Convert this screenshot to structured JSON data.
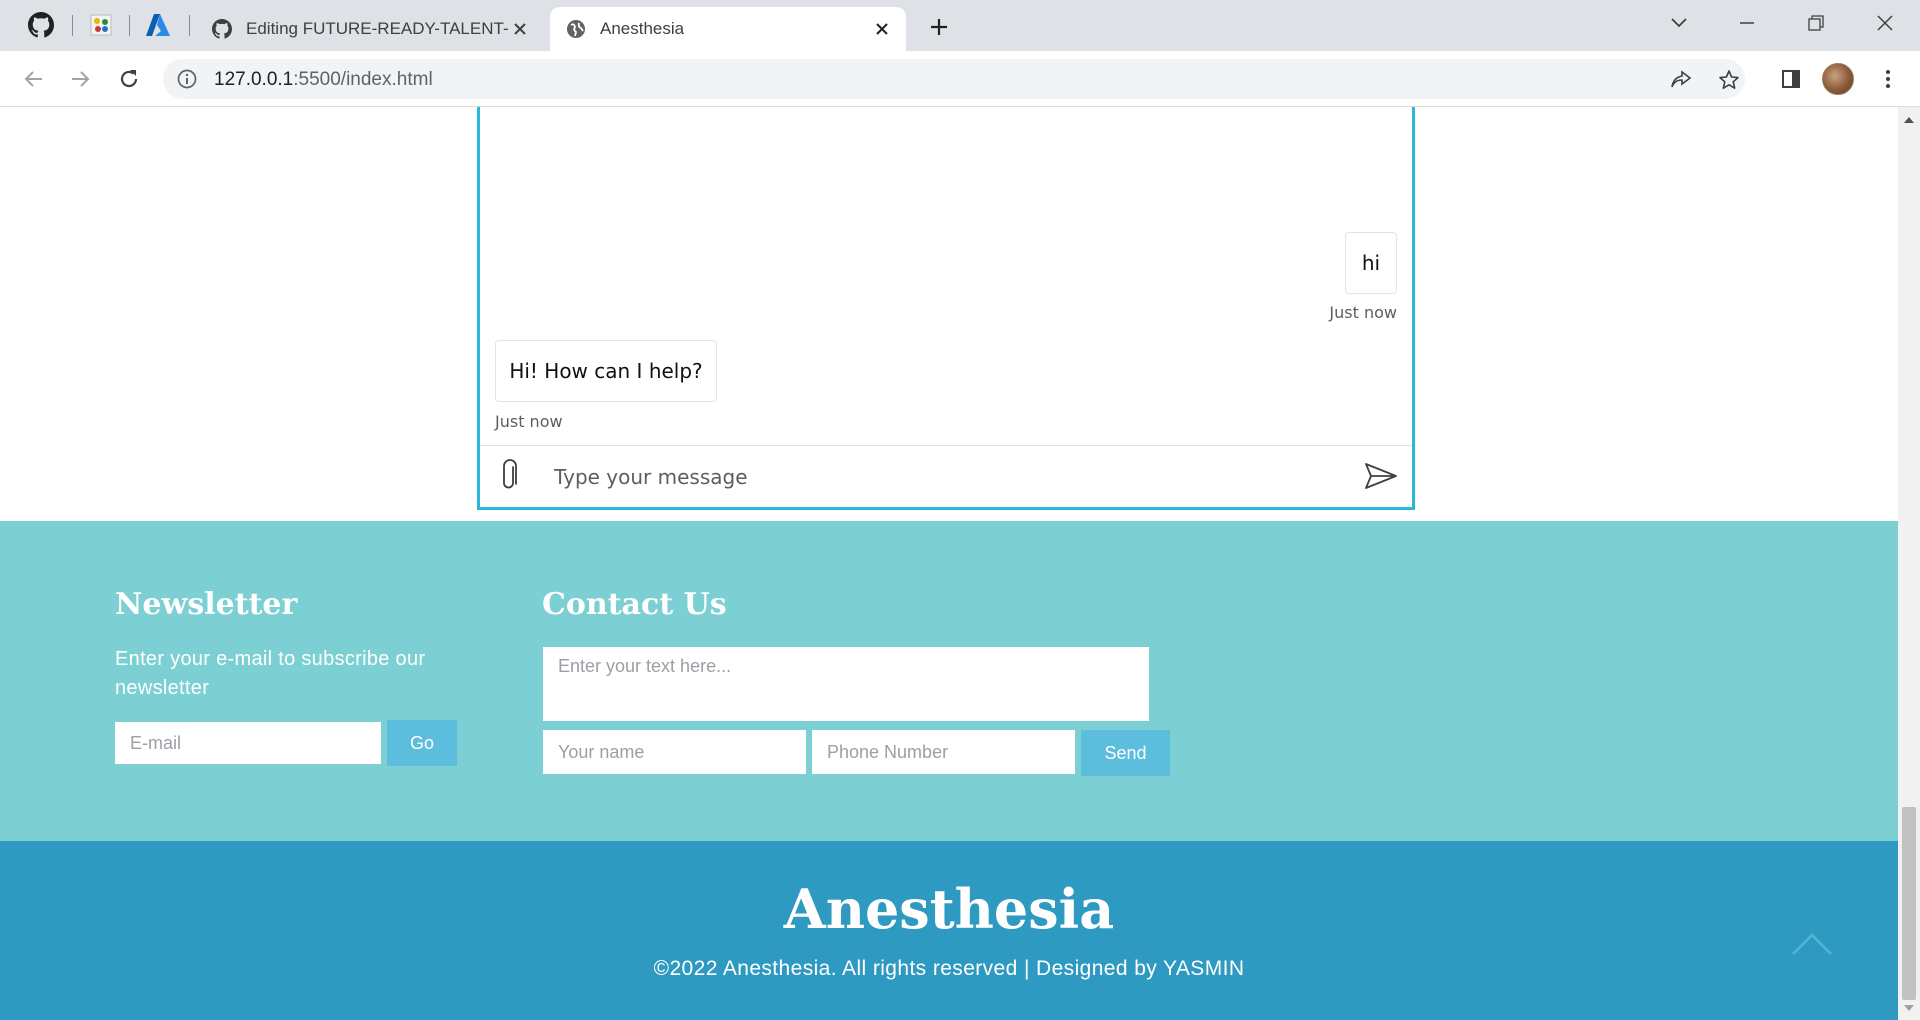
{
  "browser": {
    "tabs": [
      {
        "title": "Editing FUTURE-READY-TALENT-",
        "favicon": "github-icon"
      },
      {
        "title": "Anesthesia",
        "favicon": "globe-icon"
      }
    ],
    "url_host": "127.0.0.1",
    "url_rest": ":5500/index.html"
  },
  "chat": {
    "messages": [
      {
        "from": "user",
        "text": "hi",
        "time": "Just now"
      },
      {
        "from": "bot",
        "text": "Hi! How can I help?",
        "time": "Just now"
      }
    ],
    "input_placeholder": "Type your message"
  },
  "newsletter": {
    "heading": "Newsletter",
    "description": "Enter your e-mail to subscribe our newsletter",
    "email_placeholder": "E-mail",
    "button": "Go"
  },
  "contact": {
    "heading": "Contact Us",
    "message_placeholder": "Enter your text here...",
    "name_placeholder": "Your name",
    "phone_placeholder": "Phone Number",
    "button": "Send"
  },
  "footer": {
    "brand": "Anesthesia",
    "copyright": "©2022 Anesthesia. All rights reserved | Designed by YASMIN"
  },
  "colors": {
    "accent_border": "#2bb7d9",
    "band": "#7ccfd2",
    "button": "#5cbddc",
    "footer": "#2f9ac1"
  }
}
